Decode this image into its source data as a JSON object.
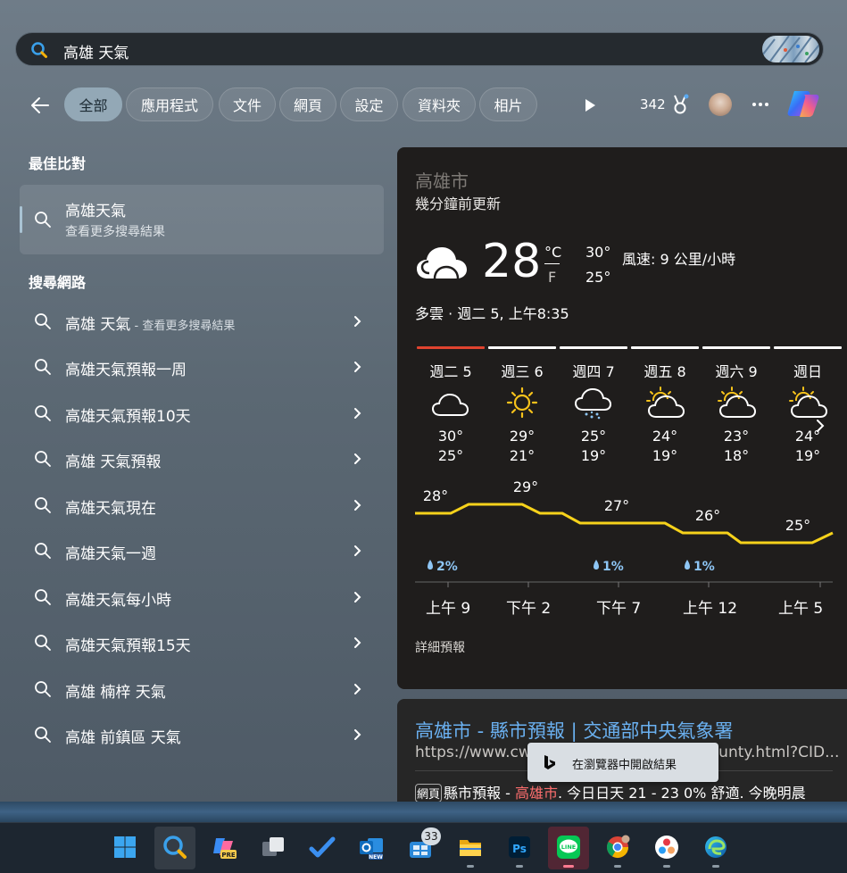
{
  "search": {
    "query": "高雄 天氣"
  },
  "tabs": [
    "全部",
    "應用程式",
    "文件",
    "網頁",
    "設定",
    "資料夾",
    "相片"
  ],
  "rewards": {
    "points": "342"
  },
  "best_match": {
    "heading": "最佳比對",
    "title": "高雄天氣",
    "subtitle": "查看更多搜尋結果"
  },
  "web_search": {
    "heading": "搜尋網路",
    "items": [
      {
        "text": "高雄 天氣",
        "suffix": " - 查看更多搜尋結果"
      },
      {
        "text": "高雄天氣預報一周",
        "suffix": ""
      },
      {
        "text": "高雄天氣預報10天",
        "suffix": ""
      },
      {
        "text": "高雄 天氣預報",
        "suffix": ""
      },
      {
        "text": "高雄天氣現在",
        "suffix": ""
      },
      {
        "text": "高雄天氣一週",
        "suffix": ""
      },
      {
        "text": "高雄天氣每小時",
        "suffix": ""
      },
      {
        "text": "高雄天氣預報15天",
        "suffix": ""
      },
      {
        "text": "高雄 楠梓 天氣",
        "suffix": ""
      },
      {
        "text": "高雄 前鎮區 天氣",
        "suffix": ""
      }
    ]
  },
  "weather": {
    "city": "高雄市",
    "updated": "幾分鐘前更新",
    "temp": "28",
    "unit_c": "°C",
    "unit_f": "F",
    "high": "30°",
    "low": "25°",
    "wind": "風速: 9 公里/小時",
    "condition": "多雲 · 週二 5, 上午8:35",
    "days": [
      {
        "label": "週二 5",
        "icon": "cloud-icon",
        "high": "30°",
        "low": "25°"
      },
      {
        "label": "週三 6",
        "icon": "sun-icon",
        "high": "29°",
        "low": "21°"
      },
      {
        "label": "週四 7",
        "icon": "rain-cloud-icon",
        "high": "25°",
        "low": "19°"
      },
      {
        "label": "週五 8",
        "icon": "partly-cloudy-icon",
        "high": "24°",
        "low": "19°"
      },
      {
        "label": "週六 9",
        "icon": "partly-cloudy-icon",
        "high": "23°",
        "low": "18°"
      },
      {
        "label": "週日",
        "icon": "partly-cloudy-icon",
        "high": "24°",
        "low": "19°"
      }
    ],
    "hourly_temps": [
      "28°",
      "29°",
      "27°",
      "26°",
      "25°"
    ],
    "precip": [
      "2%",
      "1%",
      "1%"
    ],
    "hour_labels": [
      "上午 9",
      "下午 2",
      "下午 7",
      "上午 12",
      "上午 5"
    ],
    "detail_link": "詳細預報",
    "colors": {
      "line": "#f6d21b",
      "precip": "#8ec6f5",
      "today_bar": "#e0432f"
    }
  },
  "result": {
    "title": "高雄市 - 縣市預報 | 交通部中央氣象署",
    "url": "https://www.cwa",
    "url_tail": "unty.html?CID...",
    "badge": "網頁",
    "snippet_a": "縣市預報 - ",
    "snippet_hl": "高雄市",
    "snippet_b": ". 今日日天 21 - 23 0% 舒適. 今晚明晨"
  },
  "open_in_browser": "在瀏覽器中開啟結果",
  "taskbar": {
    "badge_count": "33"
  }
}
